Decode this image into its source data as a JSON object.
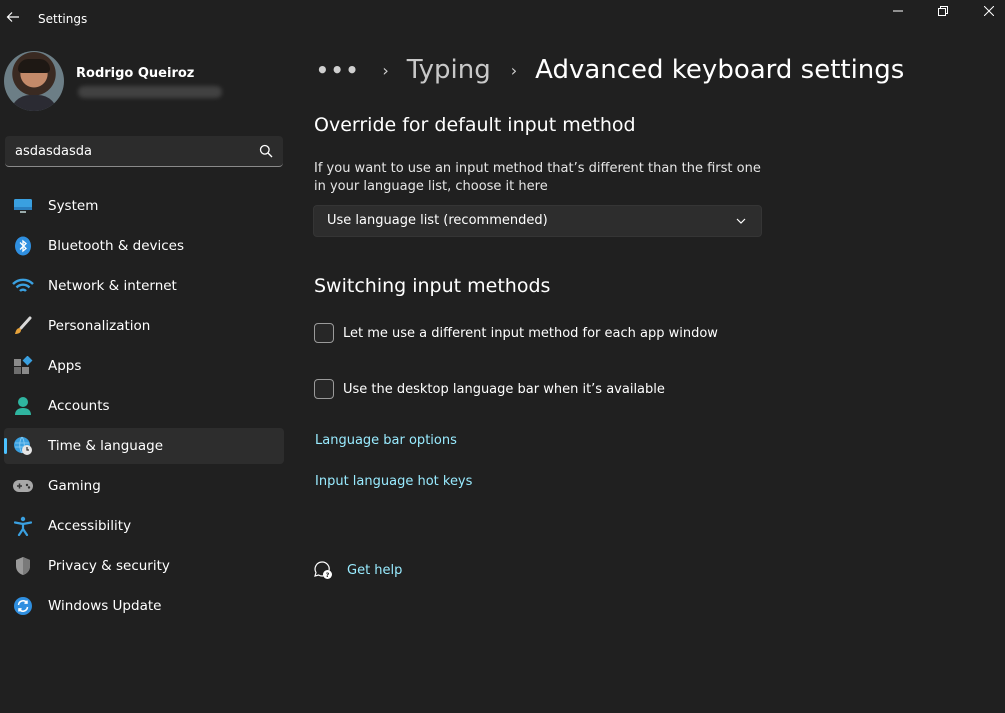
{
  "window": {
    "title": "Settings"
  },
  "user": {
    "name": "Rodrigo Queiroz"
  },
  "search": {
    "value": "asdasdasda"
  },
  "nav": {
    "items": [
      {
        "label": "System",
        "icon": "monitor-icon"
      },
      {
        "label": "Bluetooth & devices",
        "icon": "bluetooth-icon"
      },
      {
        "label": "Network & internet",
        "icon": "wifi-icon"
      },
      {
        "label": "Personalization",
        "icon": "brush-icon"
      },
      {
        "label": "Apps",
        "icon": "apps-icon"
      },
      {
        "label": "Accounts",
        "icon": "person-icon"
      },
      {
        "label": "Time & language",
        "icon": "globe-clock-icon",
        "active": true
      },
      {
        "label": "Gaming",
        "icon": "gamepad-icon"
      },
      {
        "label": "Accessibility",
        "icon": "accessibility-icon"
      },
      {
        "label": "Privacy & security",
        "icon": "shield-icon"
      },
      {
        "label": "Windows Update",
        "icon": "update-icon"
      }
    ]
  },
  "breadcrumb": {
    "more": "•••",
    "sep": "›",
    "parent": "Typing",
    "current": "Advanced keyboard settings"
  },
  "override": {
    "title": "Override for default input method",
    "description": "If you want to use an input method that’s different than the first one in your language list, choose it here",
    "dropdown_value": "Use language list (recommended)"
  },
  "switching": {
    "title": "Switching input methods",
    "option1": "Let me use a different input method for each app window",
    "option2": "Use the desktop language bar when it’s available"
  },
  "links": {
    "language_bar": "Language bar options",
    "hot_keys": "Input language hot keys",
    "help": "Get help"
  },
  "colors": {
    "accent": "#4cc2ff",
    "link": "#99ebff",
    "background": "#202020"
  }
}
